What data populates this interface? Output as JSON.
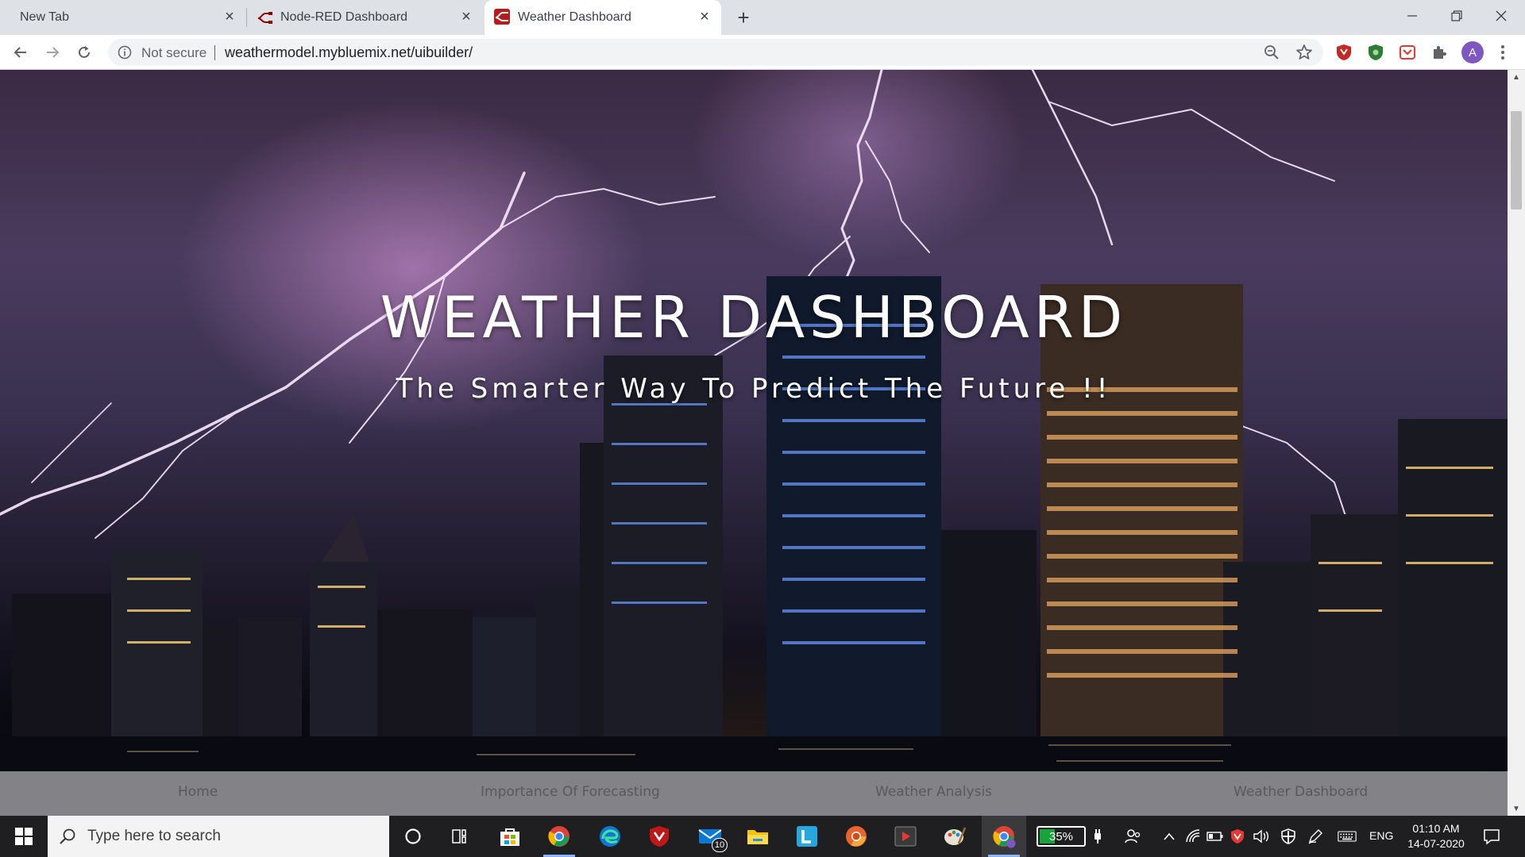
{
  "browser": {
    "tabs": [
      {
        "title": "New Tab",
        "active": false
      },
      {
        "title": "Node-RED Dashboard",
        "active": false
      },
      {
        "title": "Weather Dashboard",
        "active": true
      }
    ],
    "security_label": "Not secure",
    "url": "weathermodel.mybluemix.net/uibuilder/",
    "profile_initial": "A",
    "extension_colors": {
      "shield_red": "#c62828",
      "shield_green": "#2e7d32",
      "pocket": "#e53935"
    }
  },
  "page": {
    "hero_title": "WEATHER DASHBOARD",
    "hero_subtitle": "The Smarter Way To Predict The Future !!",
    "nav": [
      {
        "label": "Home"
      },
      {
        "label": "Importance Of Forecasting"
      },
      {
        "label": "Weather Analysis"
      },
      {
        "label": "Weather Dashboard"
      }
    ]
  },
  "taskbar": {
    "search_placeholder": "Type here to search",
    "mail_badge": "10",
    "battery_percent": "35%",
    "battery_level": 0.35,
    "language": "ENG",
    "time": "01:10 AM",
    "date": "14-07-2020",
    "pinned_apps": [
      "cortana-icon",
      "task-view-icon",
      "store-icon",
      "chrome-icon",
      "edge-icon",
      "mcafee-icon",
      "mail-icon",
      "file-explorer-icon",
      "launcher-icon",
      "chrome-canary-icon",
      "media-player-icon",
      "paint-icon",
      "chrome-profile-icon"
    ]
  }
}
